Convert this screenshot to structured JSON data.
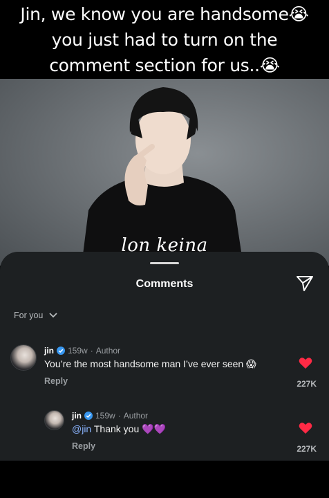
{
  "caption": {
    "line1": "Jin, we know you are handsome😭",
    "line2": "you just had to turn on the",
    "line3": "comment section for us..😭"
  },
  "watermark": "lon keina",
  "sheet": {
    "title": "Comments",
    "filter_label": "For you"
  },
  "comments": [
    {
      "author": "jin",
      "time": "159w",
      "separator": "·",
      "badge": "Author",
      "text": "You’re the most handsome man I’ve ever seen 😱",
      "reply_label": "Reply",
      "likes": "227K"
    },
    {
      "author": "jin",
      "time": "159w",
      "separator": "·",
      "badge": "Author",
      "mention": "@jin",
      "text": "Thank you 💜💜",
      "reply_label": "Reply",
      "likes": "227K"
    }
  ],
  "colors": {
    "sheet_bg": "#1d2022",
    "heart": "#ff2a45",
    "verified": "#3897f0",
    "mention": "#8ab4ff"
  }
}
